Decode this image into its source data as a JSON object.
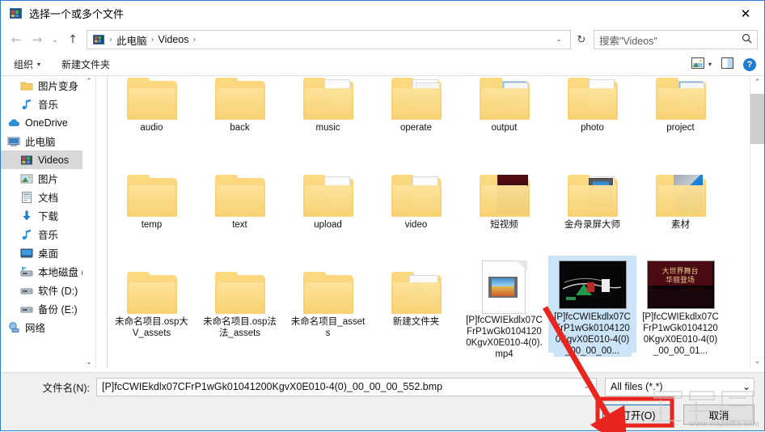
{
  "window": {
    "title": "选择一个或多个文件",
    "title_icon": "video-file-icon",
    "close_label": "✕"
  },
  "nav": {
    "back_icon": "arrow-left-icon",
    "forward_icon": "arrow-right-icon",
    "recent_icon": "chevron-down-icon",
    "up_icon": "arrow-up-icon",
    "address_icon": "video-library-icon",
    "breadcrumbs": [
      "此电脑",
      "Videos"
    ],
    "separator": "›",
    "dropdown_icon": "chevron-down-icon",
    "refresh_icon": "refresh-icon",
    "refresh_glyph": "↻"
  },
  "search": {
    "placeholder": "搜索\"Videos\"",
    "icon": "search-icon",
    "glyph": "⌕"
  },
  "toolbar": {
    "organize_label": "组织",
    "organize_caret": "▾",
    "new_folder_label": "新建文件夹",
    "view_icon": "view-layout-icon",
    "view_caret": "▾",
    "pane_icon": "preview-pane-icon",
    "help_icon": "help-icon",
    "help_glyph": "?"
  },
  "sidebar": {
    "scroll_up_glyph": "⌃",
    "scroll_down_glyph": "⌄",
    "items": [
      {
        "label": "图片变身",
        "icon": "folder-icon",
        "selected": false,
        "indent": 1
      },
      {
        "label": "音乐",
        "icon": "music-note-icon",
        "selected": false,
        "indent": 1
      },
      {
        "label": "OneDrive",
        "icon": "onedrive-cloud-icon",
        "selected": false,
        "indent": 0
      },
      {
        "label": "此电脑",
        "icon": "this-pc-icon",
        "selected": false,
        "indent": 0
      },
      {
        "label": "Videos",
        "icon": "videos-folder-icon",
        "selected": true,
        "indent": 1
      },
      {
        "label": "图片",
        "icon": "pictures-folder-icon",
        "selected": false,
        "indent": 1
      },
      {
        "label": "文档",
        "icon": "documents-folder-icon",
        "selected": false,
        "indent": 1
      },
      {
        "label": "下载",
        "icon": "downloads-icon",
        "selected": false,
        "indent": 1
      },
      {
        "label": "音乐",
        "icon": "music-note-icon",
        "selected": false,
        "indent": 1
      },
      {
        "label": "桌面",
        "icon": "desktop-icon",
        "selected": false,
        "indent": 1
      },
      {
        "label": "本地磁盘 (C",
        "icon": "system-drive-icon",
        "selected": false,
        "indent": 1
      },
      {
        "label": "软件 (D:)",
        "icon": "drive-icon",
        "selected": false,
        "indent": 1
      },
      {
        "label": "备份 (E:)",
        "icon": "drive-icon",
        "selected": false,
        "indent": 1
      },
      {
        "label": "网络",
        "icon": "network-icon",
        "selected": false,
        "indent": 0
      }
    ]
  },
  "filelist": {
    "scroll_up_glyph": "⌃",
    "scroll_down_glyph": "⌄",
    "items": [
      {
        "label": "audio",
        "icon": "folder-plain",
        "selected": false
      },
      {
        "label": "back",
        "icon": "folder-plain",
        "selected": false
      },
      {
        "label": "music",
        "icon": "folder-sheet",
        "selected": false
      },
      {
        "label": "operate",
        "icon": "folder-lines",
        "selected": false
      },
      {
        "label": "output",
        "icon": "folder-picture",
        "selected": false
      },
      {
        "label": "photo",
        "icon": "folder-sheet",
        "selected": false
      },
      {
        "label": "project",
        "icon": "folder-picture",
        "selected": false
      },
      {
        "label": "temp",
        "icon": "folder-plain",
        "selected": false
      },
      {
        "label": "text",
        "icon": "folder-plain",
        "selected": false
      },
      {
        "label": "upload",
        "icon": "folder-sheet",
        "selected": false
      },
      {
        "label": "video",
        "icon": "folder-sheet",
        "selected": false
      },
      {
        "label": "短视频",
        "icon": "folder-dark-poster",
        "selected": false
      },
      {
        "label": "金舟录屏大师",
        "icon": "folder-film",
        "selected": false
      },
      {
        "label": "素材",
        "icon": "folder-windows",
        "selected": false
      },
      {
        "label": "未命名项目.osp大V_assets",
        "icon": "folder-plain",
        "selected": false
      },
      {
        "label": "未命名项目.osp法法_assets",
        "icon": "folder-plain",
        "selected": false
      },
      {
        "label": "未命名项目_assets",
        "icon": "folder-plain",
        "selected": false
      },
      {
        "label": "新建文件夹",
        "icon": "folder-mp4",
        "selected": false
      },
      {
        "label": "[P]fcCWIEkdlx07CFrP1wGk01041200KgvX0E010-4(0).mp4",
        "icon": "video-file-page",
        "selected": false
      },
      {
        "label": "[P]fcCWIEkdlx07CFrP1wGk01041200KgvX0E010-4(0)_00_00_00...",
        "icon": "video-thumbnail-a",
        "selected": true
      },
      {
        "label": "[P]fcCWIEkdlx07CFrP1wGk01041200KgvX0E010-4(0)_00_00_01...",
        "icon": "video-thumbnail-b",
        "selected": false
      }
    ]
  },
  "footer": {
    "filename_label": "文件名(N):",
    "filename_value": "[P]fcCWIEkdlx07CFrP1wGk01041200KgvX0E010-4(0)_00_00_00_552.bmp",
    "filename_dropdown_icon": "chevron-down-icon",
    "filetype_value": "All files (*.*)",
    "filetype_dropdown_icon": "chevron-down-icon",
    "open_button": "打开(O)",
    "cancel_button": "取消"
  },
  "annotation": {
    "arrow": "red-arrow",
    "highlight": "red-box-around-open-button",
    "color": "#e8251e"
  },
  "watermark": {
    "text": "www.xiazaiba.com"
  }
}
